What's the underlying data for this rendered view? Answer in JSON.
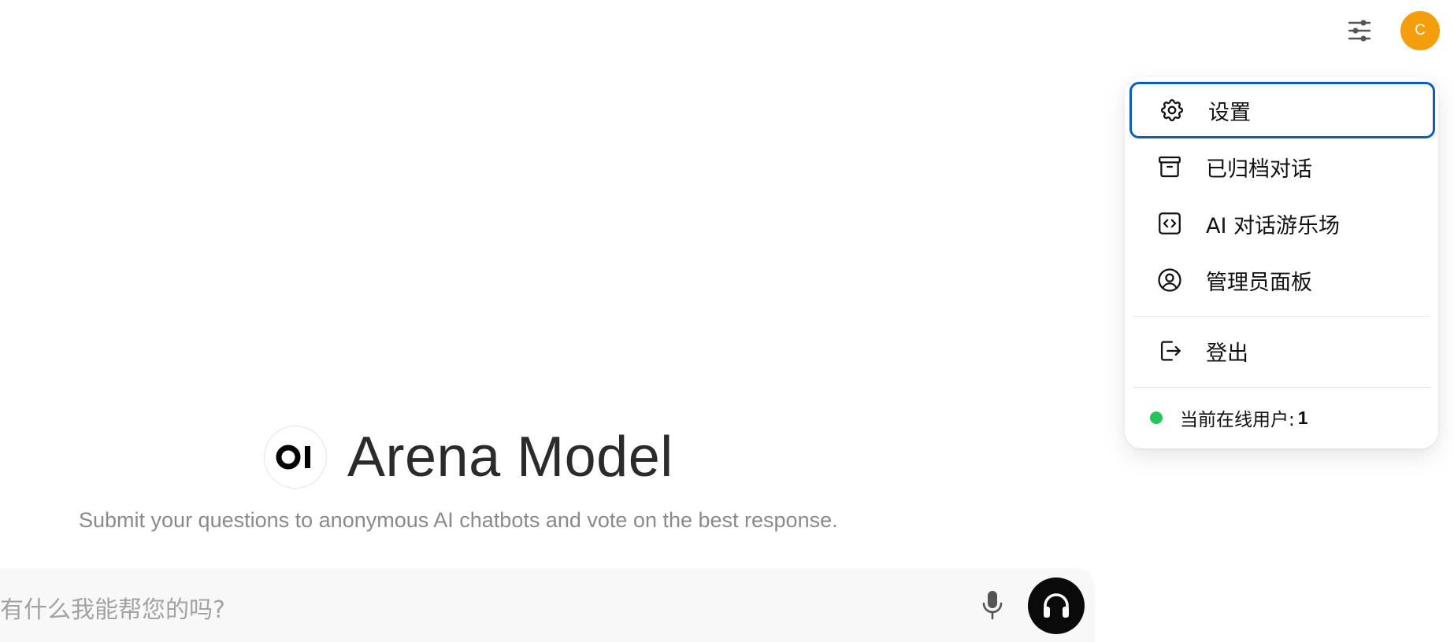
{
  "header": {
    "controls_icon": "sliders-icon",
    "avatar_initial": "C",
    "avatar_color": "#f59e0b"
  },
  "hero": {
    "logo_text": "OI",
    "model_name": "Arena Model",
    "subtitle": "Submit your questions to anonymous AI chatbots and vote on the best response."
  },
  "input": {
    "placeholder": "有什么我能帮您的吗?",
    "mic_icon": "microphone-icon",
    "voice_icon": "headphones-icon"
  },
  "menu": {
    "items": [
      {
        "label": "设置",
        "icon": "gear-icon"
      },
      {
        "label": "已归档对话",
        "icon": "archive-icon"
      },
      {
        "label": "AI 对话游乐场",
        "icon": "code-icon"
      },
      {
        "label": "管理员面板",
        "icon": "user-circle-icon"
      },
      {
        "label": "登出",
        "icon": "sign-out-icon"
      }
    ],
    "online_label": "当前在线用户:",
    "online_count": "1",
    "online_color": "#22c55e",
    "focus_color": "#0b5cc4"
  }
}
